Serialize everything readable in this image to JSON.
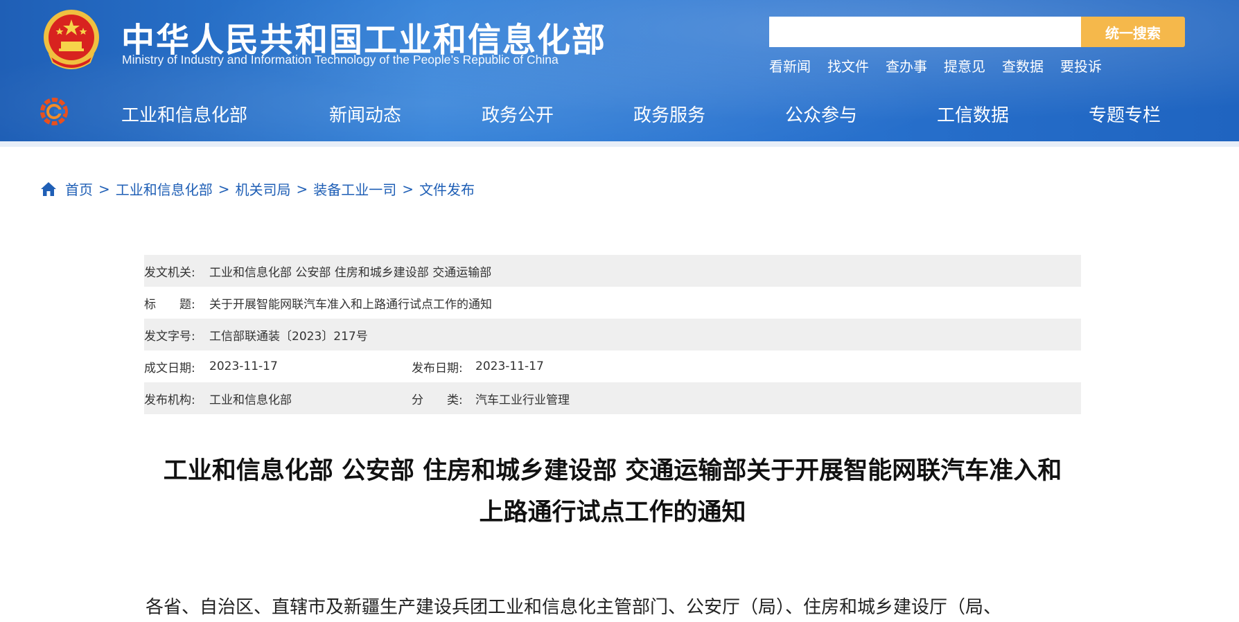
{
  "header": {
    "title_cn": "中华人民共和国工业和信息化部",
    "title_en": "Ministry of Industry and Information Technology of the People’s Republic of China",
    "search_placeholder": "",
    "search_button": "统一搜索",
    "quick_links": [
      "看新闻",
      "找文件",
      "查办事",
      "提意见",
      "查数据",
      "要投诉"
    ],
    "colors": {
      "header_blue": "#2a74d0",
      "search_button": "#f5b84b"
    }
  },
  "nav": {
    "items": [
      "工业和信息化部",
      "新闻动态",
      "政务公开",
      "政务服务",
      "公众参与",
      "工信数据",
      "专题专栏"
    ]
  },
  "breadcrumb": {
    "icon": "home-icon",
    "items": [
      "首页",
      "工业和信息化部",
      "机关司局",
      "装备工业一司",
      "文件发布"
    ],
    "separator": ">"
  },
  "meta": {
    "issuer_label": "发文机关:",
    "issuer": "工业和信息化部 公安部 住房和城乡建设部 交通运输部",
    "title_label": "标　　题:",
    "title": "关于开展智能网联汽车准入和上路通行试点工作的通知",
    "doc_no_label": "发文字号:",
    "doc_no": "工信部联通装〔2023〕217号",
    "created_label": "成文日期:",
    "created": "2023-11-17",
    "published_label": "发布日期:",
    "published": "2023-11-17",
    "org_label": "发布机构:",
    "org": "工业和信息化部",
    "category_label": "分　　类:",
    "category": "汽车工业行业管理"
  },
  "article": {
    "title_line1": "工业和信息化部 公安部 住房和城乡建设部 交通运输部关于开展智能网联汽车准入和",
    "title_line2": "上路通行试点工作的通知",
    "body_line1": "各省、自治区、直辖市及新疆生产建设兵团工业和信息化主管部门、公安厅（局）、住房和城乡建设厅（局、"
  }
}
